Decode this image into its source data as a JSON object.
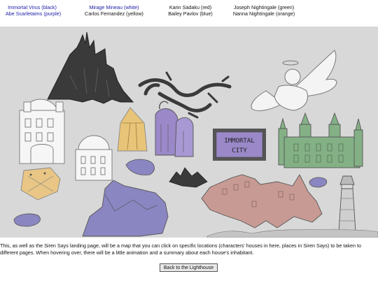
{
  "credits": [
    {
      "link": "Immortal Virus (black)",
      "link2": "Abe Scarletaims (purple)"
    },
    {
      "link": "Mirage Mineau (white)",
      "text": "Carlos Fernandez (yellow)"
    },
    {
      "text": "Karin Sadaku (red)",
      "text2": "Bailey Pavlov (blue)"
    },
    {
      "text": "Joseph Nightingale (green)",
      "text2": "Nanna Nightingale (orange)"
    }
  ],
  "map": {
    "sign_line1": "IMMORTAL",
    "sign_line2": "CITY",
    "colors": {
      "background": "#d8d8d8",
      "black": "#3a3a3a",
      "purple": "#9a88c8",
      "yellow": "#e8c478",
      "red": "#c89a94",
      "blue": "#8a86c2",
      "green": "#84b086",
      "orange": "#e6c07c"
    }
  },
  "description": "This, as well as the Siren Says landing page, will be a map that you can click on specific locations (characters' houses in here, places in Siren Says) to be taken to different pages. When hovering over, there will be a little animation and a summary about each house's inhabitant.",
  "back_button": "Back to the Lighthouse"
}
